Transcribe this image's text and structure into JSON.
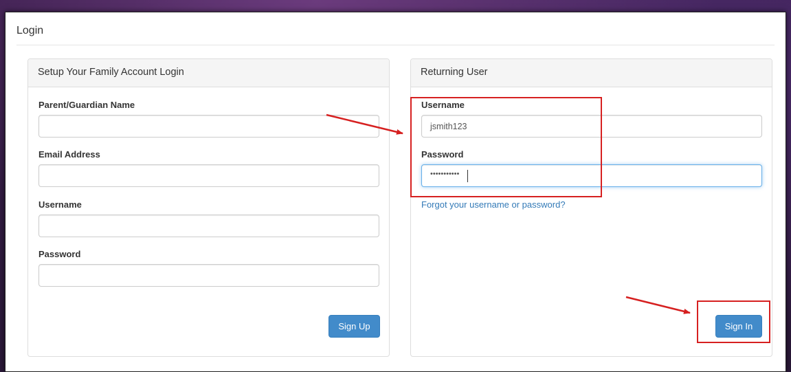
{
  "page": {
    "title": "Login"
  },
  "signup": {
    "heading": "Setup Your Family Account Login",
    "fields": [
      {
        "label": "Parent/Guardian Name",
        "value": ""
      },
      {
        "label": "Email Address",
        "value": ""
      },
      {
        "label": "Username",
        "value": ""
      },
      {
        "label": "Password",
        "value": ""
      }
    ],
    "button": "Sign Up"
  },
  "signin": {
    "heading": "Returning User",
    "username_label": "Username",
    "username_value": "jsmith123",
    "password_label": "Password",
    "password_masked": "•••••••••••",
    "forgot_link": "Forgot your username or password?",
    "button": "Sign In"
  },
  "colors": {
    "primary_button": "#428bca",
    "link": "#337ab7",
    "annotation": "#d62020",
    "focus_border": "#66afe9"
  },
  "annotations": [
    "red-box-credentials",
    "red-arrow-to-credentials",
    "red-box-sign-in",
    "red-arrow-to-sign-in"
  ]
}
